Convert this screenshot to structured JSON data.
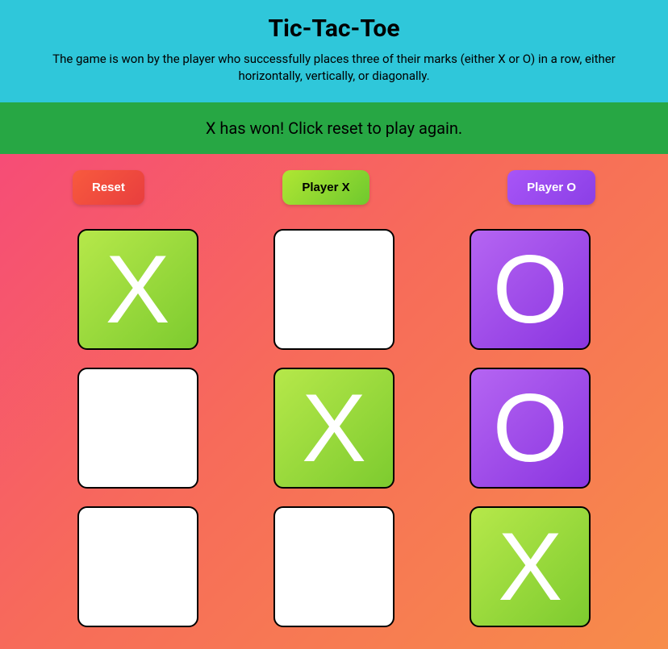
{
  "header": {
    "title": "Tic-Tac-Toe",
    "subtitle": "The game is won by the player who successfully places three of their marks (either X or O) in a row, either horizontally, vertically, or diagonally."
  },
  "status": {
    "message": "X has won! Click reset to play again."
  },
  "controls": {
    "reset_label": "Reset",
    "player_x_label": "Player X",
    "player_o_label": "Player O"
  },
  "board": {
    "cells": [
      "X",
      "",
      "O",
      "",
      "X",
      "O",
      "",
      "",
      "X"
    ]
  },
  "colors": {
    "header_bg": "#2fc7da",
    "status_bg": "#27a744",
    "x_gradient_start": "#b6e84a",
    "x_gradient_end": "#7dcb2f",
    "o_gradient_start": "#b565f2",
    "o_gradient_end": "#8a35e0",
    "reset_gradient_start": "#f85a3e",
    "reset_gradient_end": "#e83e3e"
  }
}
